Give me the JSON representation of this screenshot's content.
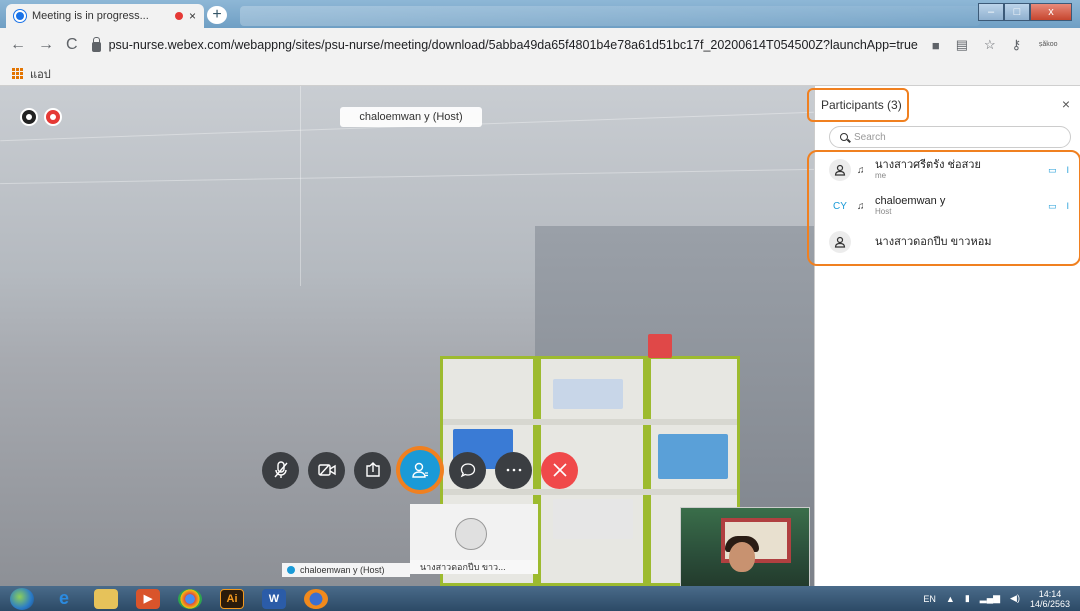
{
  "browser": {
    "tab_title": "Meeting is in progress...",
    "tab_close": "×",
    "new_tab": "+",
    "url": "psu-nurse.webex.com/webappng/sites/psu-nurse/meeting/download/5abba49da65f4801b4e78a61d51bc17f_20200614T054500Z?launchApp=true",
    "nav_back": "←",
    "nav_forward": "→",
    "nav_reload": "C",
    "profile_text": "ṣăkoo",
    "menu": "⋮",
    "bookmarks_apps_label": "แอป"
  },
  "meeting": {
    "active_speaker_label": "chaloemwan y (Host)",
    "host_thumbnail_label": "chaloemwan y (Host)",
    "attendee_thumbnail_label": "นางสาวดอกปีบ ขาว...",
    "controls": [
      {
        "name": "mute-button",
        "icon": "mic-off-icon"
      },
      {
        "name": "video-button",
        "icon": "video-off-icon"
      },
      {
        "name": "share-button",
        "icon": "share-icon"
      },
      {
        "name": "participants-button",
        "icon": "participants-icon"
      },
      {
        "name": "chat-button",
        "icon": "chat-icon"
      },
      {
        "name": "more-button",
        "icon": "more-icon"
      },
      {
        "name": "leave-button",
        "icon": "close-icon"
      }
    ],
    "accent_color": "#1a9ad7",
    "highlight_color": "#f08020",
    "end_color": "#f0494a"
  },
  "participants_panel": {
    "title": "Participants (3)",
    "close": "×",
    "search_placeholder": "Search",
    "participants": [
      {
        "name": "นางสาวศรีตรัง ช่อสวย",
        "role": "me",
        "avatar": "person-icon"
      },
      {
        "name": "chaloemwan y",
        "role": "Host",
        "avatar": "CY"
      },
      {
        "name": "นางสาวดอกปีบ ขาวหอม",
        "role": "",
        "avatar": "person-icon"
      }
    ]
  },
  "taskbar": {
    "language": "EN",
    "time": "14:14",
    "date": "14/6/2563"
  }
}
